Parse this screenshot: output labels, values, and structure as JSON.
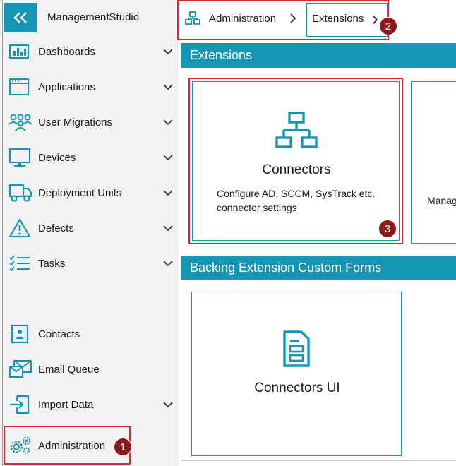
{
  "app": {
    "title": "ManagementStudio"
  },
  "sidebar": {
    "items": [
      {
        "label": "Dashboards",
        "icon": "bar-chart-icon",
        "expandable": true
      },
      {
        "label": "Applications",
        "icon": "window-icon",
        "expandable": true
      },
      {
        "label": "User Migrations",
        "icon": "users-icon",
        "expandable": true
      },
      {
        "label": "Devices",
        "icon": "monitor-icon",
        "expandable": true
      },
      {
        "label": "Deployment Units",
        "icon": "truck-icon",
        "expandable": true
      },
      {
        "label": "Defects",
        "icon": "warning-icon",
        "expandable": true
      },
      {
        "label": "Tasks",
        "icon": "checklist-icon",
        "expandable": true
      },
      {
        "label": "Contacts",
        "icon": "contact-card-icon",
        "expandable": false
      },
      {
        "label": "Email Queue",
        "icon": "email-icon",
        "expandable": false
      },
      {
        "label": "Import Data",
        "icon": "import-icon",
        "expandable": true
      },
      {
        "label": "Administration",
        "icon": "gears-icon",
        "expandable": false
      }
    ]
  },
  "breadcrumb": {
    "items": [
      "Administration",
      "Extensions"
    ]
  },
  "sections": [
    {
      "title": "Extensions"
    },
    {
      "title": "Backing Extension Custom Forms"
    }
  ],
  "tiles": {
    "connectors": {
      "title": "Connectors",
      "description": "Configure AD, SCCM, SysTrack etc. connector settings"
    },
    "partial": {
      "description": "Manag"
    },
    "connectors_ui": {
      "title": "Connectors UI"
    }
  },
  "badges": [
    "1",
    "2",
    "3"
  ],
  "colors": {
    "accent": "#1696b5",
    "highlight": "#d9282f",
    "badge": "#8b1a1a"
  }
}
